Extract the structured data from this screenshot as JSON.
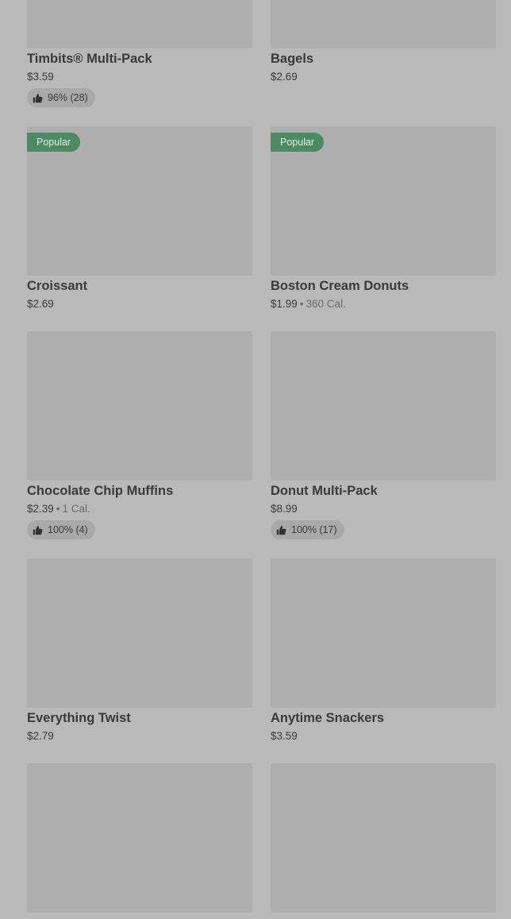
{
  "items": [
    {
      "name": "Timbits® Multi-Pack",
      "price": "$3.59",
      "calories": "",
      "rating": "96% (28)",
      "badge": ""
    },
    {
      "name": "Bagels",
      "price": "$2.69",
      "calories": "",
      "rating": "",
      "badge": ""
    },
    {
      "name": "Croissant",
      "price": "$2.69",
      "calories": "",
      "rating": "",
      "badge": "Popular"
    },
    {
      "name": "Boston Cream Donuts",
      "price": "$1.99",
      "calories": "360 Cal.",
      "rating": "",
      "badge": "Popular"
    },
    {
      "name": "Chocolate Chip Muffins",
      "price": "$2.39",
      "calories": "1 Cal.",
      "rating": "100% (4)",
      "badge": ""
    },
    {
      "name": "Donut Multi-Pack",
      "price": "$8.99",
      "calories": "",
      "rating": "100% (17)",
      "badge": ""
    },
    {
      "name": "Everything Twist",
      "price": "$2.79",
      "calories": "",
      "rating": "",
      "badge": ""
    },
    {
      "name": "Anytime Snackers",
      "price": "$3.59",
      "calories": "",
      "rating": "",
      "badge": ""
    },
    {
      "name": "",
      "price": "",
      "calories": "",
      "rating": "",
      "badge": ""
    },
    {
      "name": "",
      "price": "",
      "calories": "",
      "rating": "",
      "badge": ""
    }
  ],
  "separator": "•",
  "icons": {
    "rating": "thumbs-up-icon"
  },
  "colors": {
    "badge": "#4b8a63",
    "background": "#b9b9b9"
  }
}
